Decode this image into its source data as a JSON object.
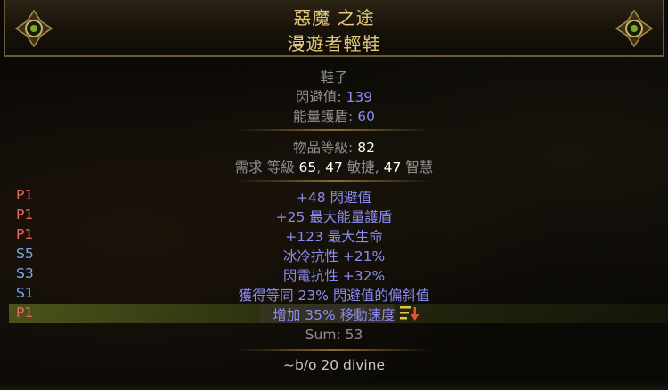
{
  "header": {
    "title1": "惡魔 之途",
    "title2": "漫遊者輕鞋"
  },
  "item": {
    "base_type": "鞋子",
    "evasion_label": "閃避值: ",
    "evasion_value": "139",
    "es_label": "能量護盾: ",
    "es_value": "60",
    "ilvl_label": "物品等級: ",
    "ilvl_value": "82",
    "req_prefix": "需求 等級 ",
    "req_level": "65",
    "req_sep1": ", ",
    "req_dex": "47",
    "req_dex_label": " 敏捷, ",
    "req_int": "47",
    "req_int_label": " 智慧"
  },
  "mods": [
    {
      "tier": "P1",
      "text": "+48 閃避值"
    },
    {
      "tier": "P1",
      "text": "+25 最大能量護盾"
    },
    {
      "tier": "P1",
      "text": "+123 最大生命"
    },
    {
      "tier": "S5",
      "text": "冰冷抗性 +21%"
    },
    {
      "tier": "S3",
      "text": "閃電抗性 +32%"
    },
    {
      "tier": "S1",
      "text": "獲得等同 23% 閃避值的偏斜值"
    },
    {
      "tier": "P1",
      "text": "增加 35% 移動速度"
    }
  ],
  "sum_text": "Sum: 53",
  "note_text": "~b/o 20 divine",
  "colors": {
    "title": "#e3c97b",
    "magic_mod": "#8b8cf0",
    "prefix_tier": "#e66a5e",
    "suffix_tier": "#79a7e6",
    "label_gray": "#8f8f8f"
  },
  "icons": {
    "ornament": "ornate-gem-icon",
    "flag": "mod-flag-arrow-icon"
  }
}
